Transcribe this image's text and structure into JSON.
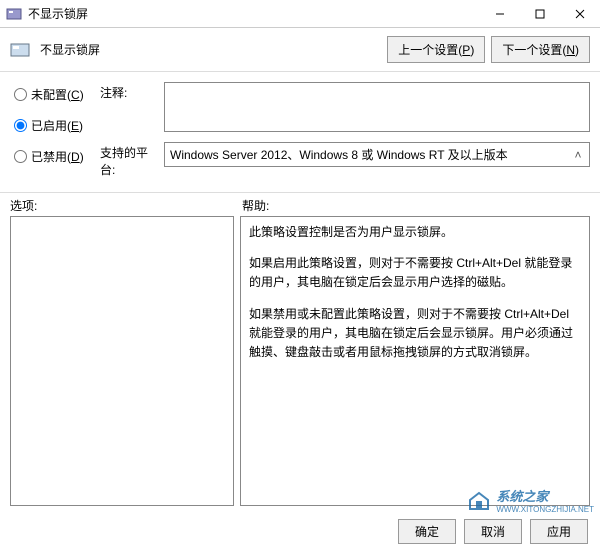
{
  "window": {
    "title": "不显示锁屏"
  },
  "header": {
    "title": "不显示锁屏",
    "prev": "上一个设置",
    "prev_key": "P",
    "next": "下一个设置",
    "next_key": "N"
  },
  "radios": {
    "not_configured": "未配置",
    "not_configured_key": "C",
    "enabled": "已启用",
    "enabled_key": "E",
    "disabled": "已禁用",
    "disabled_key": "D",
    "selected": "enabled"
  },
  "fields": {
    "comment_label": "注释:",
    "comment_value": "",
    "platform_label": "支持的平台:",
    "platform_value": "Windows Server 2012、Windows 8 或 Windows RT 及以上版本"
  },
  "sections": {
    "options_label": "选项:",
    "help_label": "帮助:",
    "help_text": [
      "此策略设置控制是否为用户显示锁屏。",
      "如果启用此策略设置，则对于不需要按 Ctrl+Alt+Del 就能登录的用户，其电脑在锁定后会显示用户选择的磁贴。",
      "如果禁用或未配置此策略设置，则对于不需要按 Ctrl+Alt+Del 就能登录的用户，其电脑在锁定后会显示锁屏。用户必须通过触摸、键盘敲击或者用鼠标拖拽锁屏的方式取消锁屏。"
    ]
  },
  "buttons": {
    "ok": "确定",
    "cancel": "取消",
    "apply": "应用"
  },
  "watermark": {
    "text": "系统之家",
    "url": "WWW.XITONGZHIJIA.NET"
  }
}
